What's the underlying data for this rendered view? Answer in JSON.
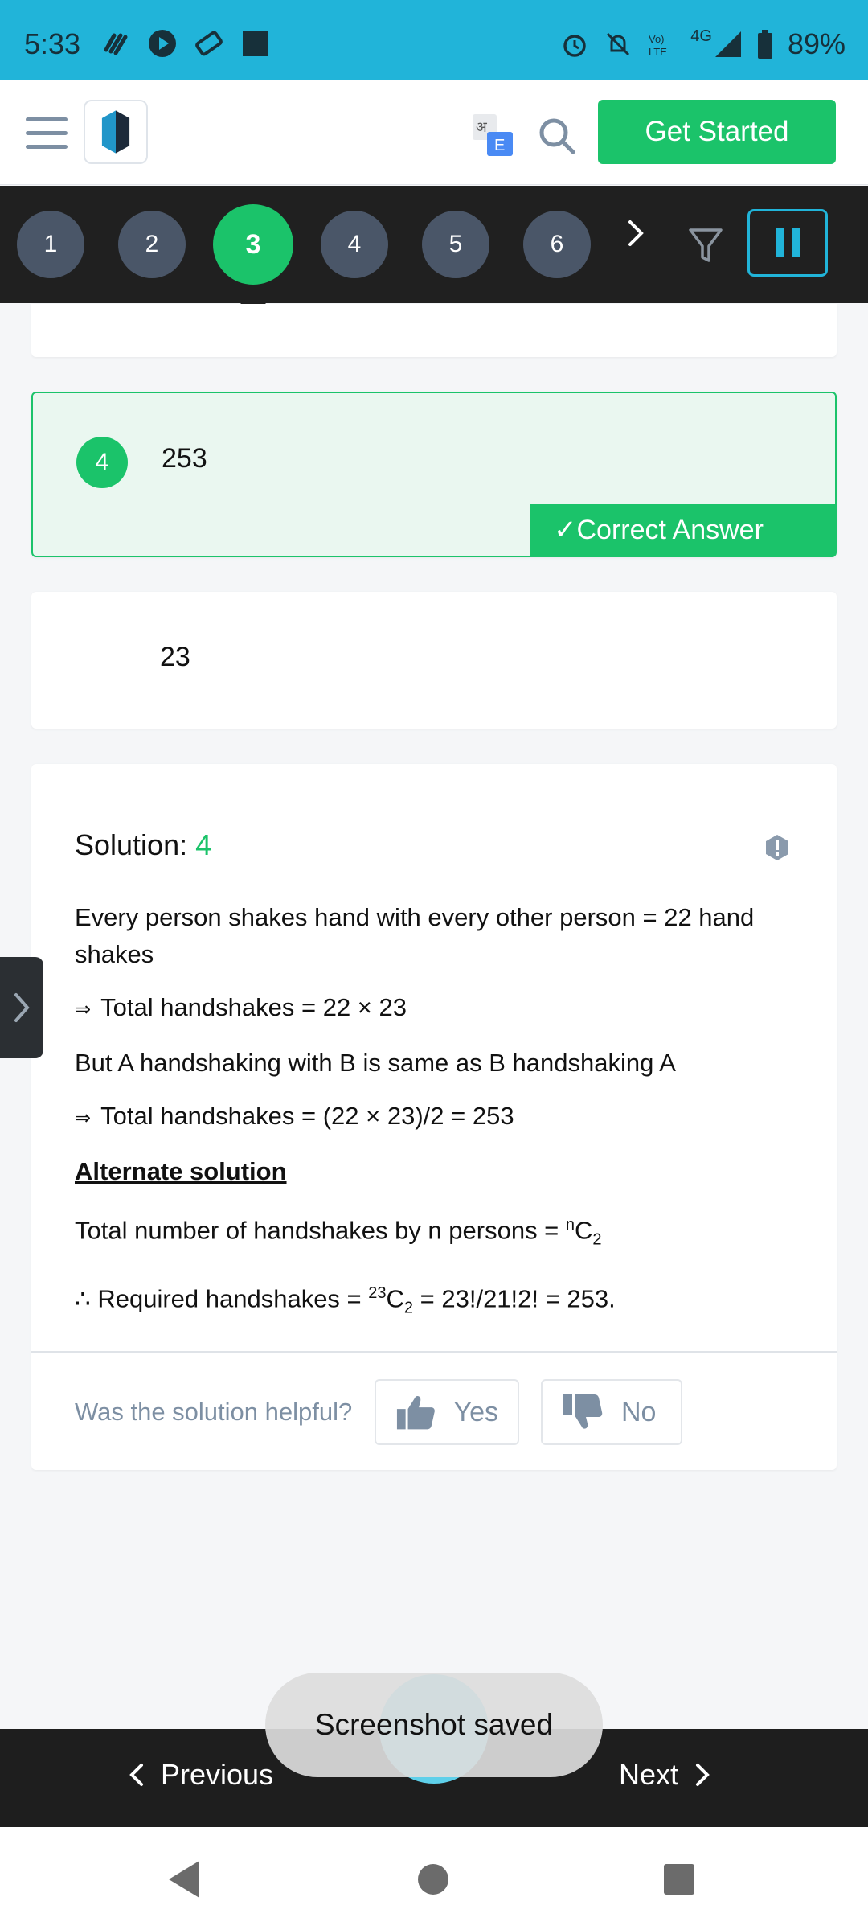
{
  "status_bar": {
    "time": "5:33",
    "network": "4G",
    "battery": "89%",
    "icons": [
      "gesture-icon",
      "play-icon",
      "ticket-icon",
      "square-icon",
      "alarm-icon",
      "bell-off-icon",
      "volte-icon",
      "signal-icon",
      "battery-icon"
    ],
    "background": "#21b4d9"
  },
  "header": {
    "get_started_label": "Get Started",
    "brand_color": "#1bc36a",
    "translate_labels": {
      "hindi": "अ",
      "english": "E"
    }
  },
  "question_nav": {
    "items": [
      "1",
      "2",
      "3",
      "4",
      "5",
      "6"
    ],
    "active": "3"
  },
  "options": [
    {
      "number": "4",
      "text": "253",
      "correct": true,
      "tag": "✓Correct Answer"
    },
    {
      "number": "",
      "text": "23",
      "correct": false
    }
  ],
  "solution": {
    "label": "Solution:",
    "answer": "4",
    "line1": "Every person shakes hand with every other person = 22 hand shakes",
    "implies": "⇒",
    "line2": "Total handshakes = 22 × 23",
    "line3": "But A handshaking with B is same as B handshaking A",
    "line4": "Total handshakes = (22 × 23)/2 = 253",
    "alt_heading": "Alternate solution",
    "line5_prefix": "Total number of handshakes by n persons = ",
    "line5_sup": "n",
    "line5_C": "C",
    "line5_sub": "2",
    "line6_prefix": "∴ Required handshakes = ",
    "line6_sup": "23",
    "line6_C": "C",
    "line6_sub": "2",
    "line6_suffix": " = 23!/21!2! = 253."
  },
  "feedback": {
    "question": "Was the solution helpful?",
    "yes": "Yes",
    "no": "No"
  },
  "bottom_nav": {
    "previous": "Previous",
    "next": "Next"
  },
  "toast": "Screenshot saved"
}
